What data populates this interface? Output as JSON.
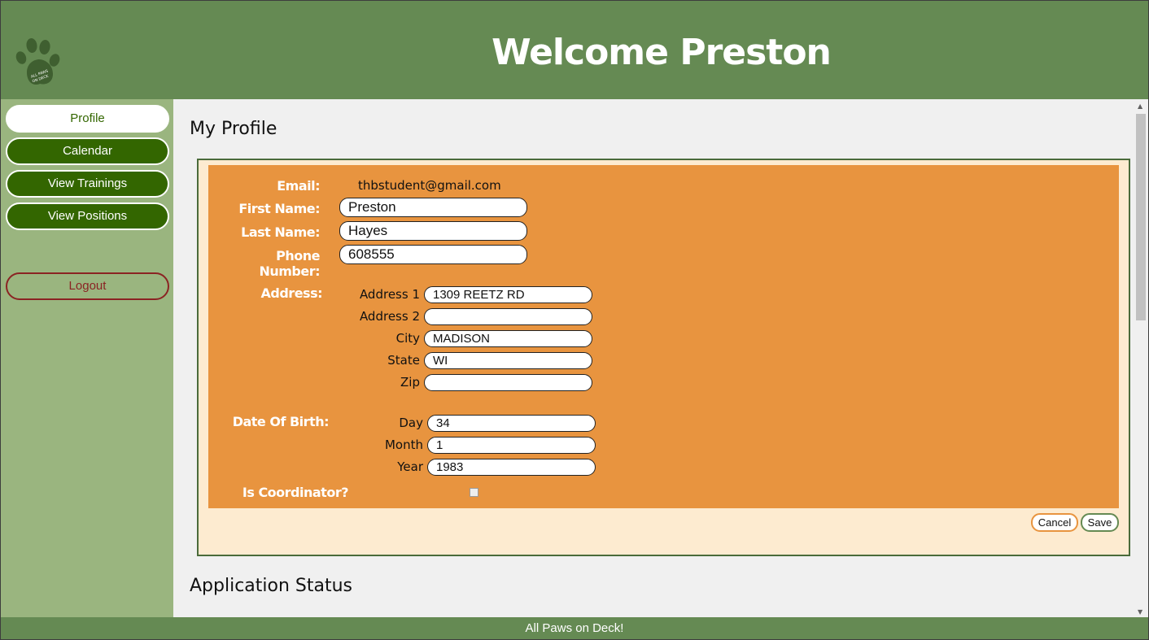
{
  "header": {
    "title": "Welcome Preston",
    "logo_text": "ALL PAWS ON DECK"
  },
  "sidebar": {
    "items": [
      {
        "label": "Profile",
        "active": true
      },
      {
        "label": "Calendar",
        "active": false
      },
      {
        "label": "View Trainings",
        "active": false
      },
      {
        "label": "View Positions",
        "active": false
      }
    ],
    "logout_label": "Logout"
  },
  "main": {
    "profile_title": "My Profile",
    "application_title": "Application Status"
  },
  "profile": {
    "email_label": "Email:",
    "email_value": "thbstudent@gmail.com",
    "first_name_label": "First Name:",
    "first_name_value": "Preston",
    "last_name_label": "Last Name:",
    "last_name_value": "Hayes",
    "phone_label": "Phone Number:",
    "phone_value": "608555",
    "address_label": "Address:",
    "address1_label": "Address 1",
    "address1_value": "1309 REETZ RD",
    "address2_label": "Address 2",
    "address2_value": "",
    "city_label": "City",
    "city_value": "MADISON",
    "state_label": "State",
    "state_value": "WI",
    "zip_label": "Zip",
    "zip_value": "",
    "dob_label": "Date Of Birth:",
    "day_label": "Day",
    "day_value": "34",
    "month_label": "Month",
    "month_value": "1",
    "year_label": "Year",
    "year_value": "1983",
    "coordinator_label": "Is Coordinator?",
    "coordinator_checked": false,
    "cancel_label": "Cancel",
    "save_label": "Save"
  },
  "footer": {
    "text": "All Paws on Deck!"
  },
  "colors": {
    "header_green": "#658a53",
    "sidebar_green": "#9ab57f",
    "nav_button_green": "#336600",
    "panel_orange": "#e8943f",
    "card_cream": "#fdebd0",
    "logout_red": "#8b2323"
  }
}
